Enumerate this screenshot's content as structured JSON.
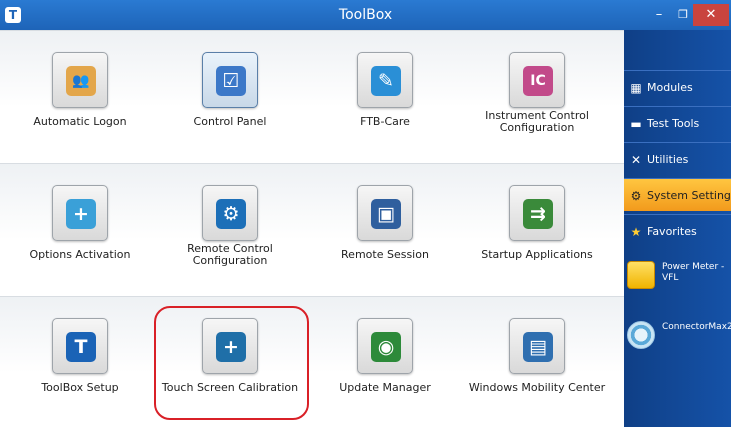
{
  "window": {
    "title": "ToolBox",
    "app_icon_letter": "T",
    "minimize_glyph": "–",
    "maximize_glyph": "❐",
    "close_glyph": "✕"
  },
  "tiles": [
    {
      "label": "Automatic Logon",
      "icon": "users-icon",
      "glyph": "👥",
      "color": "#e3a64a"
    },
    {
      "label": "Control Panel",
      "icon": "control-panel-icon",
      "glyph": "☑",
      "color": "#3c78c8"
    },
    {
      "label": "FTB-Care",
      "icon": "ftb-care-icon",
      "glyph": "✎",
      "color": "#2a8fd6"
    },
    {
      "label": "Instrument Control\nConfiguration",
      "icon": "instrument-control-icon",
      "glyph": "IC",
      "color": "#c24a8a"
    },
    {
      "label": "Options Activation",
      "icon": "options-activation-icon",
      "glyph": "+",
      "color": "#3aa0d8"
    },
    {
      "label": "Remote Control\nConfiguration",
      "icon": "remote-control-icon",
      "glyph": "⚙",
      "color": "#1c6fb8"
    },
    {
      "label": "Remote Session",
      "icon": "remote-session-icon",
      "glyph": "▣",
      "color": "#2f5f9e"
    },
    {
      "label": "Startup Applications",
      "icon": "startup-applications-icon",
      "glyph": "⇉",
      "color": "#3a8a3a"
    },
    {
      "label": "ToolBox Setup",
      "icon": "toolbox-setup-icon",
      "glyph": "T",
      "color": "#1a63b6"
    },
    {
      "label": "Touch Screen Calibration",
      "icon": "touch-screen-calibration-icon",
      "glyph": "+",
      "color": "#1f6fa8"
    },
    {
      "label": "Update Manager",
      "icon": "update-manager-icon",
      "glyph": "◉",
      "color": "#2d8a3a"
    },
    {
      "label": "Windows Mobility Center",
      "icon": "mobility-center-icon",
      "glyph": "▤",
      "color": "#2f6fb0"
    }
  ],
  "sidebar": {
    "items": [
      {
        "label": "Modules",
        "icon": "modules-icon",
        "glyph": "▦",
        "active": false
      },
      {
        "label": "Test Tools",
        "icon": "test-tools-icon",
        "glyph": "▬",
        "active": false
      },
      {
        "label": "Utilities",
        "icon": "utilities-icon",
        "glyph": "✕",
        "active": false
      },
      {
        "label": "System Settings",
        "icon": "system-settings-icon",
        "glyph": "⚙",
        "active": true
      },
      {
        "label": "Favorites",
        "icon": "favorites-icon",
        "glyph": "★",
        "active": false
      }
    ],
    "apps": [
      {
        "label": "Power Meter -\nVFL",
        "icon": "power-meter-icon"
      },
      {
        "label": "ConnectorMax2",
        "icon": "connectormax-icon"
      }
    ]
  },
  "colors": {
    "highlight": "#d92027",
    "active_item": "#f7b02c",
    "sidebar": "#124a9a"
  }
}
